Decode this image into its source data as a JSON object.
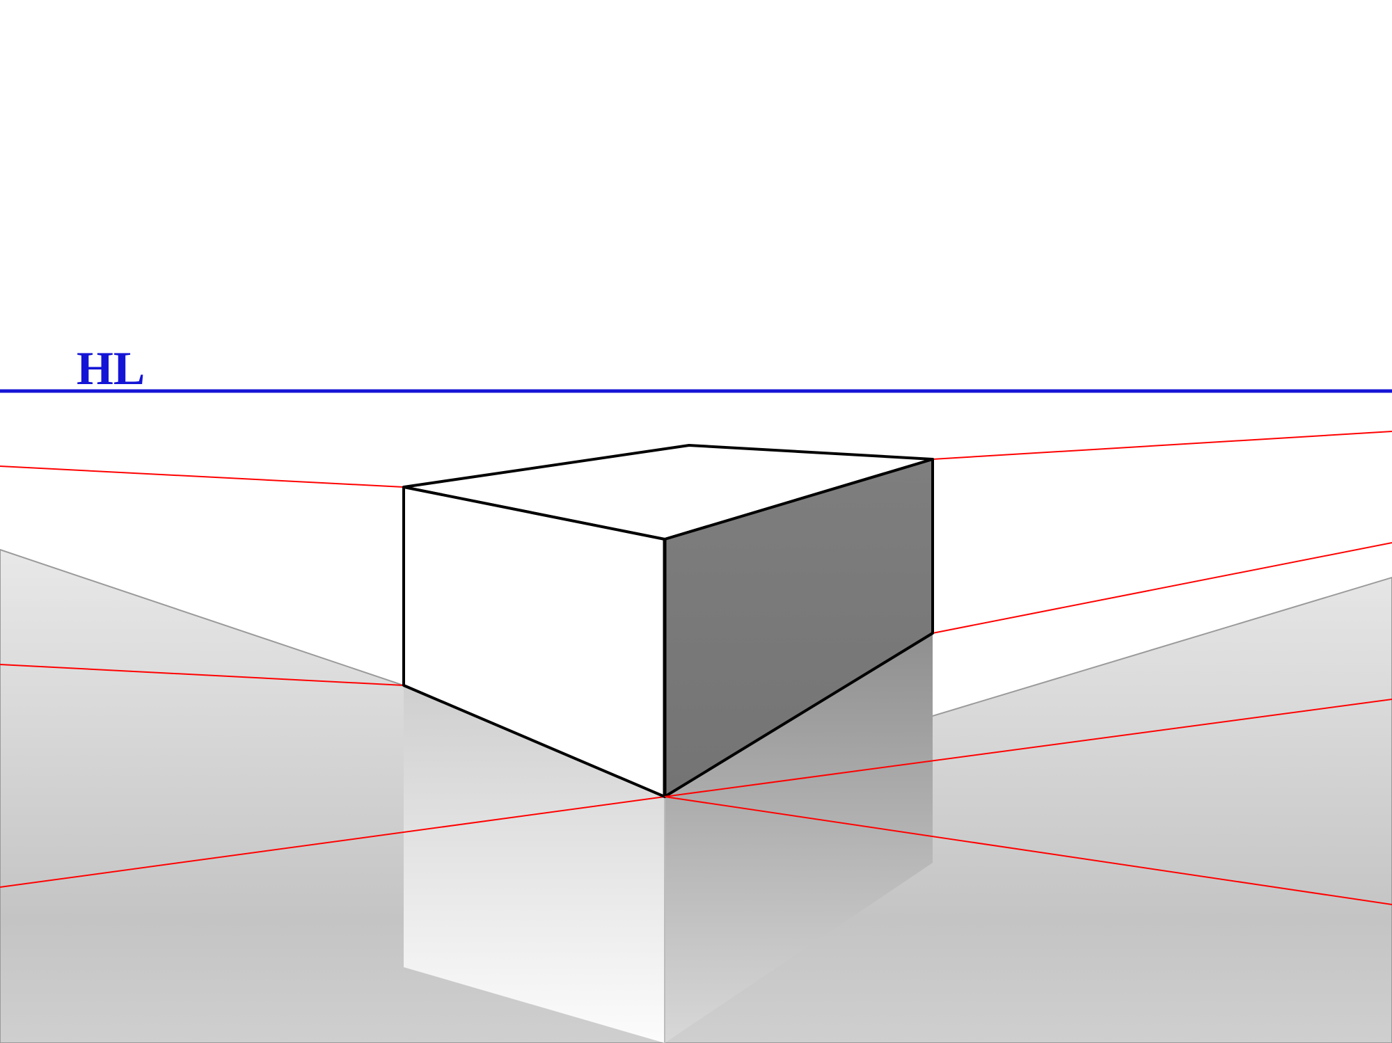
{
  "diagram": {
    "label_hl": "HL",
    "colors": {
      "horizon_line": "#1414d6",
      "perspective_line": "#ff0000",
      "cube_outline": "#000000",
      "cube_top": "#ffffff",
      "cube_front": "#ffffff",
      "cube_side": "#7a7a7a",
      "ground_light": "#ededed",
      "ground_dark": "#b9b9b9",
      "reflection_front_top": "#e2e2e2",
      "reflection_front_bottom": "#ffffff",
      "reflection_side_top": "#9a9a9a",
      "reflection_side_bottom": "#dcdcdc",
      "ground_outline": "#9a9a9a"
    },
    "geometry_note": "Two-point perspective cube resting on a reflective ground plane. 'HL' labels the horizon line. Red lines are perspective construction lines to off-screen vanishing points left and right."
  }
}
